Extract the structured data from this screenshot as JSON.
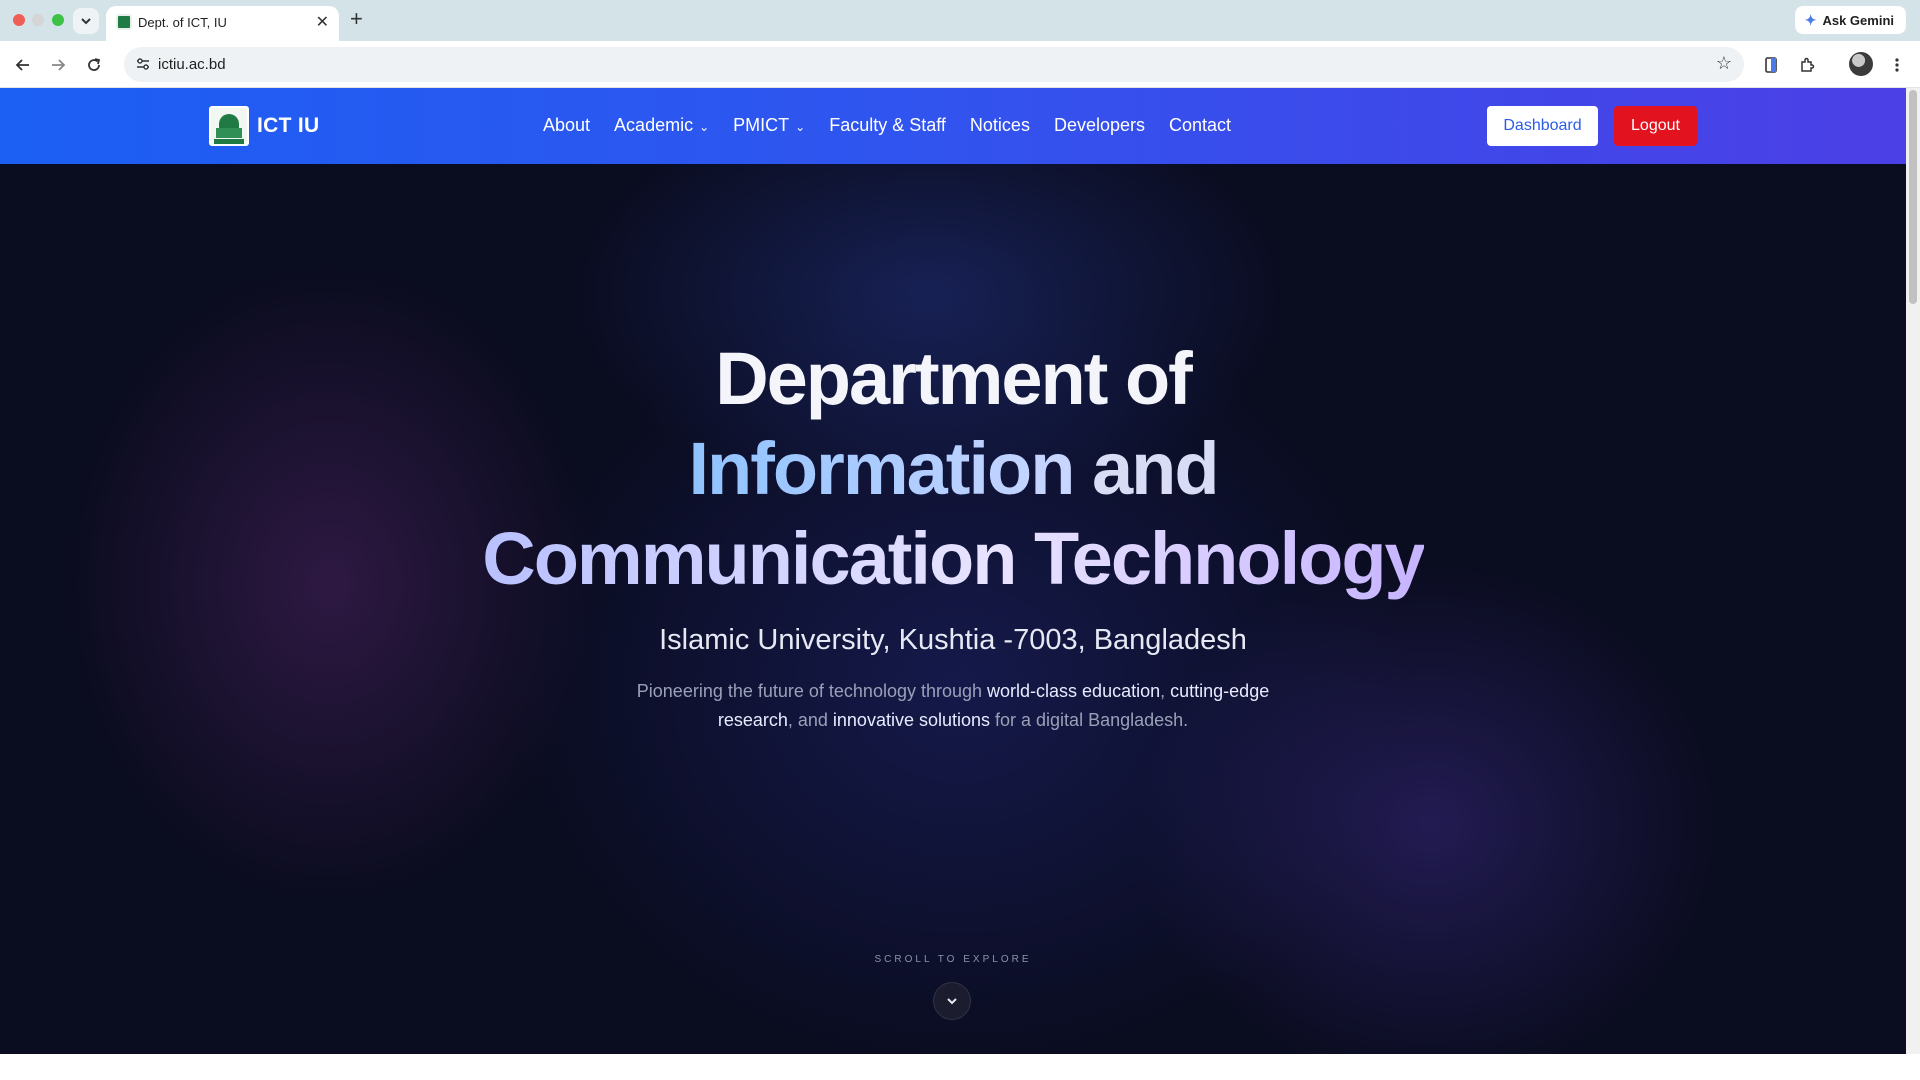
{
  "browser": {
    "tab_title": "Dept. of ICT, IU",
    "url": "ictiu.ac.bd",
    "ask_gemini_label": "Ask Gemini",
    "close_glyph": "✕",
    "new_tab_glyph": "+"
  },
  "site": {
    "brand_name": "ICT IU",
    "menu": [
      {
        "label": "About",
        "has_dropdown": false
      },
      {
        "label": "Academic",
        "has_dropdown": true
      },
      {
        "label": "PMICT",
        "has_dropdown": true
      },
      {
        "label": "Faculty & Staff",
        "has_dropdown": false
      },
      {
        "label": "Notices",
        "has_dropdown": false
      },
      {
        "label": "Developers",
        "has_dropdown": false
      },
      {
        "label": "Contact",
        "has_dropdown": false
      }
    ],
    "dashboard_label": "Dashboard",
    "logout_label": "Logout",
    "colors": {
      "navbar_start": "#1c5ff3",
      "navbar_end": "#4b3fe6",
      "logout_red": "#e2121e",
      "hero_background": "#0a0c1f"
    }
  },
  "hero": {
    "title_line1": "Department of",
    "title_line2_a": "Information",
    "title_line2_b": " and",
    "title_line3": "Communication Technology",
    "subtitle": "Islamic University, Kushtia -7003, Bangladesh",
    "desc_1": "Pioneering the future of technology through ",
    "desc_hl_1": "world-class education",
    "desc_2": ", ",
    "desc_hl_2": "cutting-edge research",
    "desc_3": ", and ",
    "desc_hl_3": "innovative solutions",
    "desc_4": " for a digital Bangladesh.",
    "scroll_label": "SCROLL TO EXPLORE"
  },
  "icons": {
    "back": "arrow-left-icon",
    "forward": "arrow-right-icon",
    "reload": "reload-icon",
    "site_info": "tune-icon",
    "bookmark": "star-icon",
    "scroll_down": "chevron-down-icon"
  }
}
